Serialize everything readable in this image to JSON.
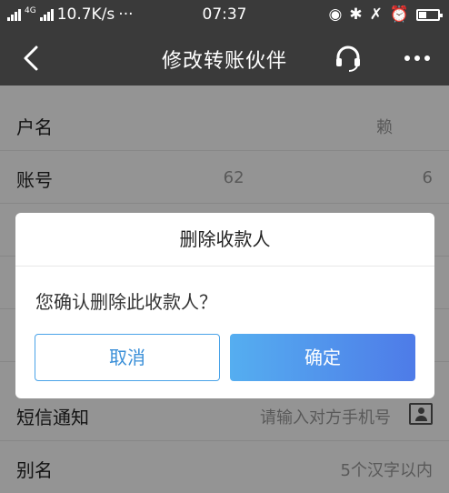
{
  "status_bar": {
    "network_label": "4G",
    "speed": "10.7K/s",
    "dots": "···",
    "time": "07:37"
  },
  "nav": {
    "back_icon": "chevron-left-icon",
    "title": "修改转账伙伴",
    "service_icon": "headset-icon",
    "more_icon": "more-dots-icon"
  },
  "form": {
    "rows": [
      {
        "label": "户名",
        "value_prefix": "赖",
        "value_suffix": ""
      },
      {
        "label": "账号",
        "value_prefix": "62",
        "value_suffix": "6"
      },
      {
        "label": "",
        "value_prefix": "",
        "value_suffix": ""
      },
      {
        "label": "",
        "value_prefix": "",
        "value_suffix": ""
      },
      {
        "label": "",
        "value_prefix": "",
        "value_suffix": ""
      },
      {
        "label": "短信通知",
        "placeholder": "请输入对方手机号"
      },
      {
        "label": "别名",
        "placeholder": "5个汉字以内"
      }
    ]
  },
  "dialog": {
    "title": "删除收款人",
    "message": "您确认删除此收款人？",
    "cancel_label": "取消",
    "confirm_label": "确定"
  },
  "colors": {
    "nav_bg": "#3a3a3a",
    "accent": "#4a90e2",
    "overlay": "rgba(0,0,0,0.42)"
  }
}
